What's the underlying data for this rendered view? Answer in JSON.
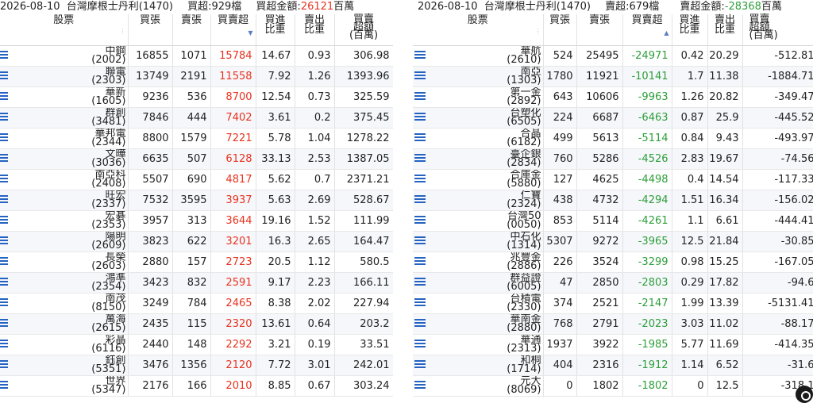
{
  "left": {
    "title": {
      "date": "2026-08-10",
      "broker": "台灣摩根士丹利(1470)",
      "count_label": "買超:929檔",
      "amount_label": "買超金額:",
      "amount_value": "26121",
      "amount_unit": "百萬"
    },
    "headers": [
      "股票",
      "買張",
      "賣張",
      "買賣超",
      "買進\n比重",
      "賣出\n比重",
      "買賣\n超額\n(百萬)"
    ],
    "rows": [
      {
        "name": "中鋼",
        "code": "(2002)",
        "buy": "16855",
        "sell": "1071",
        "net": "15784",
        "buy_pct": "14.67",
        "sell_pct": "0.93",
        "amount": "306.98"
      },
      {
        "name": "聯電",
        "code": "(2303)",
        "buy": "13749",
        "sell": "2191",
        "net": "11558",
        "buy_pct": "7.92",
        "sell_pct": "1.26",
        "amount": "1393.96"
      },
      {
        "name": "華新",
        "code": "(1605)",
        "buy": "9236",
        "sell": "536",
        "net": "8700",
        "buy_pct": "12.54",
        "sell_pct": "0.73",
        "amount": "325.59"
      },
      {
        "name": "群創",
        "code": "(3481)",
        "buy": "7846",
        "sell": "444",
        "net": "7402",
        "buy_pct": "3.61",
        "sell_pct": "0.2",
        "amount": "375.45"
      },
      {
        "name": "華邦電",
        "code": "(2344)",
        "buy": "8800",
        "sell": "1579",
        "net": "7221",
        "buy_pct": "5.78",
        "sell_pct": "1.04",
        "amount": "1278.22"
      },
      {
        "name": "文曄",
        "code": "(3036)",
        "buy": "6635",
        "sell": "507",
        "net": "6128",
        "buy_pct": "33.13",
        "sell_pct": "2.53",
        "amount": "1387.05"
      },
      {
        "name": "南亞科",
        "code": "(2408)",
        "buy": "5507",
        "sell": "690",
        "net": "4817",
        "buy_pct": "5.62",
        "sell_pct": "0.7",
        "amount": "2371.21"
      },
      {
        "name": "旺宏",
        "code": "(2337)",
        "buy": "7532",
        "sell": "3595",
        "net": "3937",
        "buy_pct": "5.63",
        "sell_pct": "2.69",
        "amount": "528.67"
      },
      {
        "name": "宏碁",
        "code": "(2353)",
        "buy": "3957",
        "sell": "313",
        "net": "3644",
        "buy_pct": "19.16",
        "sell_pct": "1.52",
        "amount": "111.99"
      },
      {
        "name": "陽明",
        "code": "(2609)",
        "buy": "3823",
        "sell": "622",
        "net": "3201",
        "buy_pct": "16.3",
        "sell_pct": "2.65",
        "amount": "164.47"
      },
      {
        "name": "長榮",
        "code": "(2603)",
        "buy": "2880",
        "sell": "157",
        "net": "2723",
        "buy_pct": "20.5",
        "sell_pct": "1.12",
        "amount": "580.5"
      },
      {
        "name": "鴻準",
        "code": "(2354)",
        "buy": "3423",
        "sell": "832",
        "net": "2591",
        "buy_pct": "9.17",
        "sell_pct": "2.23",
        "amount": "166.11"
      },
      {
        "name": "南茂",
        "code": "(8150)",
        "buy": "3249",
        "sell": "784",
        "net": "2465",
        "buy_pct": "8.38",
        "sell_pct": "2.02",
        "amount": "227.94"
      },
      {
        "name": "萬海",
        "code": "(2615)",
        "buy": "2435",
        "sell": "115",
        "net": "2320",
        "buy_pct": "13.61",
        "sell_pct": "0.64",
        "amount": "203.2"
      },
      {
        "name": "彩晶",
        "code": "(6116)",
        "buy": "2440",
        "sell": "148",
        "net": "2292",
        "buy_pct": "3.21",
        "sell_pct": "0.19",
        "amount": "33.51"
      },
      {
        "name": "鈺創",
        "code": "(5351)",
        "buy": "3476",
        "sell": "1356",
        "net": "2120",
        "buy_pct": "7.72",
        "sell_pct": "3.01",
        "amount": "242.01"
      },
      {
        "name": "世界",
        "code": "(5347)",
        "buy": "2176",
        "sell": "166",
        "net": "2010",
        "buy_pct": "8.85",
        "sell_pct": "0.67",
        "amount": "303.24"
      }
    ]
  },
  "right": {
    "title": {
      "date": "2026-08-10",
      "broker": "台灣摩根士丹利(1470)",
      "count_label": "賣超:679檔",
      "amount_label": "賣超金額:",
      "amount_value": "-28368",
      "amount_unit": "百萬"
    },
    "headers": [
      "股票",
      "買張",
      "賣張",
      "買賣超",
      "買進\n比重",
      "賣出\n比重",
      "買賣\n超額\n(百萬)"
    ],
    "rows": [
      {
        "name": "華航",
        "code": "(2610)",
        "buy": "524",
        "sell": "25495",
        "net": "-24971",
        "buy_pct": "0.42",
        "sell_pct": "20.29",
        "amount": "-512.81"
      },
      {
        "name": "南亞",
        "code": "(1303)",
        "buy": "1780",
        "sell": "11921",
        "net": "-10141",
        "buy_pct": "1.7",
        "sell_pct": "11.38",
        "amount": "-1884.71"
      },
      {
        "name": "第一金",
        "code": "(2892)",
        "buy": "643",
        "sell": "10606",
        "net": "-9963",
        "buy_pct": "1.26",
        "sell_pct": "20.82",
        "amount": "-349.47"
      },
      {
        "name": "台塑化",
        "code": "(6505)",
        "buy": "224",
        "sell": "6687",
        "net": "-6463",
        "buy_pct": "0.87",
        "sell_pct": "25.9",
        "amount": "-445.52"
      },
      {
        "name": "合晶",
        "code": "(6182)",
        "buy": "499",
        "sell": "5613",
        "net": "-5114",
        "buy_pct": "0.84",
        "sell_pct": "9.43",
        "amount": "-493.97"
      },
      {
        "name": "臺企銀",
        "code": "(2834)",
        "buy": "760",
        "sell": "5286",
        "net": "-4526",
        "buy_pct": "2.83",
        "sell_pct": "19.67",
        "amount": "-74.56"
      },
      {
        "name": "合庫金",
        "code": "(5880)",
        "buy": "127",
        "sell": "4625",
        "net": "-4498",
        "buy_pct": "0.4",
        "sell_pct": "14.54",
        "amount": "-117.33"
      },
      {
        "name": "仁寶",
        "code": "(2324)",
        "buy": "438",
        "sell": "4732",
        "net": "-4294",
        "buy_pct": "1.51",
        "sell_pct": "16.34",
        "amount": "-156.02"
      },
      {
        "name": "台灣50",
        "code": "(0050)",
        "buy": "853",
        "sell": "5114",
        "net": "-4261",
        "buy_pct": "1.1",
        "sell_pct": "6.61",
        "amount": "-444.41"
      },
      {
        "name": "中石化",
        "code": "(1314)",
        "buy": "5307",
        "sell": "9272",
        "net": "-3965",
        "buy_pct": "12.5",
        "sell_pct": "21.84",
        "amount": "-30.85"
      },
      {
        "name": "兆豐金",
        "code": "(2886)",
        "buy": "226",
        "sell": "3524",
        "net": "-3299",
        "buy_pct": "0.98",
        "sell_pct": "15.25",
        "amount": "-167.05"
      },
      {
        "name": "群益證",
        "code": "(6005)",
        "buy": "47",
        "sell": "2850",
        "net": "-2803",
        "buy_pct": "0.29",
        "sell_pct": "17.82",
        "amount": "-94.6"
      },
      {
        "name": "台積電",
        "code": "(2330)",
        "buy": "374",
        "sell": "2521",
        "net": "-2147",
        "buy_pct": "1.99",
        "sell_pct": "13.39",
        "amount": "-5131.41"
      },
      {
        "name": "華南金",
        "code": "(2880)",
        "buy": "768",
        "sell": "2791",
        "net": "-2023",
        "buy_pct": "3.03",
        "sell_pct": "11.02",
        "amount": "-88.17"
      },
      {
        "name": "華通",
        "code": "(2313)",
        "buy": "1937",
        "sell": "3922",
        "net": "-1985",
        "buy_pct": "5.77",
        "sell_pct": "11.69",
        "amount": "-414.35"
      },
      {
        "name": "和桐",
        "code": "(1714)",
        "buy": "404",
        "sell": "2316",
        "net": "-1912",
        "buy_pct": "1.14",
        "sell_pct": "6.52",
        "amount": "-31.6"
      },
      {
        "name": "元大",
        "code": "(8069)",
        "buy": "0",
        "sell": "1802",
        "net": "-1802",
        "buy_pct": "0",
        "sell_pct": "12.5",
        "amount": "-318.1"
      }
    ]
  }
}
